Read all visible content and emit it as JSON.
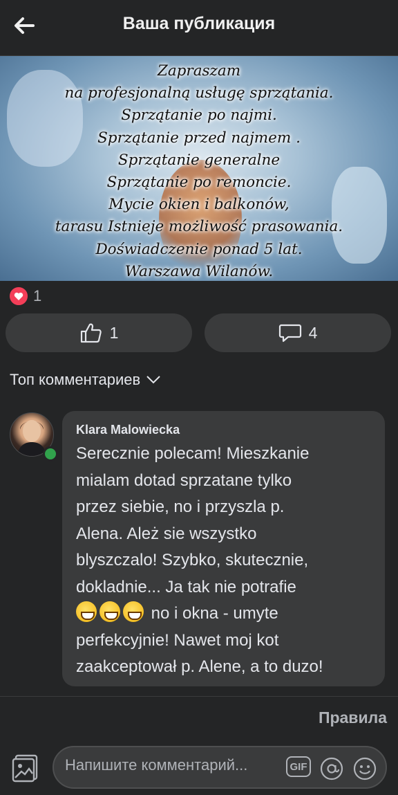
{
  "header": {
    "title": "Ваша публикация"
  },
  "post": {
    "image_lines": [
      "Zapraszam",
      "na profesjonalną usługę sprzątania.",
      "Sprzątanie po najmi.",
      "Sprzątanie przed najmem .",
      "Sprzątanie generalne",
      "Sprzątanie po remoncie.",
      "Mycie okien i balkonów,",
      "tarasu Istnieje możliwość prasowania.",
      "Doświadczenie ponad 5 lat.",
      "Warszawa Wilanów."
    ],
    "reaction_count": "1",
    "like_count": "1",
    "comment_count": "4"
  },
  "comments_section": {
    "sort_label": "Топ комментариев",
    "comment": {
      "author": "Klara Malowiecka",
      "lines": [
        "Serecznie polecam! Mieszkanie",
        "mialam dotad sprzatane tylko",
        "przez siebie, no i przyszla p.",
        "Alena. Ależ sie wszystko",
        "blyszczalo! Szybko, skutecznie,",
        "dokladnie... Ja tak nie potrafie"
      ],
      "emoji_line": "no i okna - umyte",
      "lines_after": [
        "perfekcyjnie! Nawet moj kot",
        "zaakceptował p. Alene, a to duzo!"
      ]
    }
  },
  "footer": {
    "rules_label": "Правила",
    "input_placeholder": "Напишите комментарий...",
    "gif_label": "GIF"
  },
  "colors": {
    "background": "#242526",
    "bubble": "#3a3b3c",
    "text": "#e4e6eb",
    "muted": "#b0b3b8",
    "heart": "#f33e58",
    "online": "#31a24c"
  }
}
